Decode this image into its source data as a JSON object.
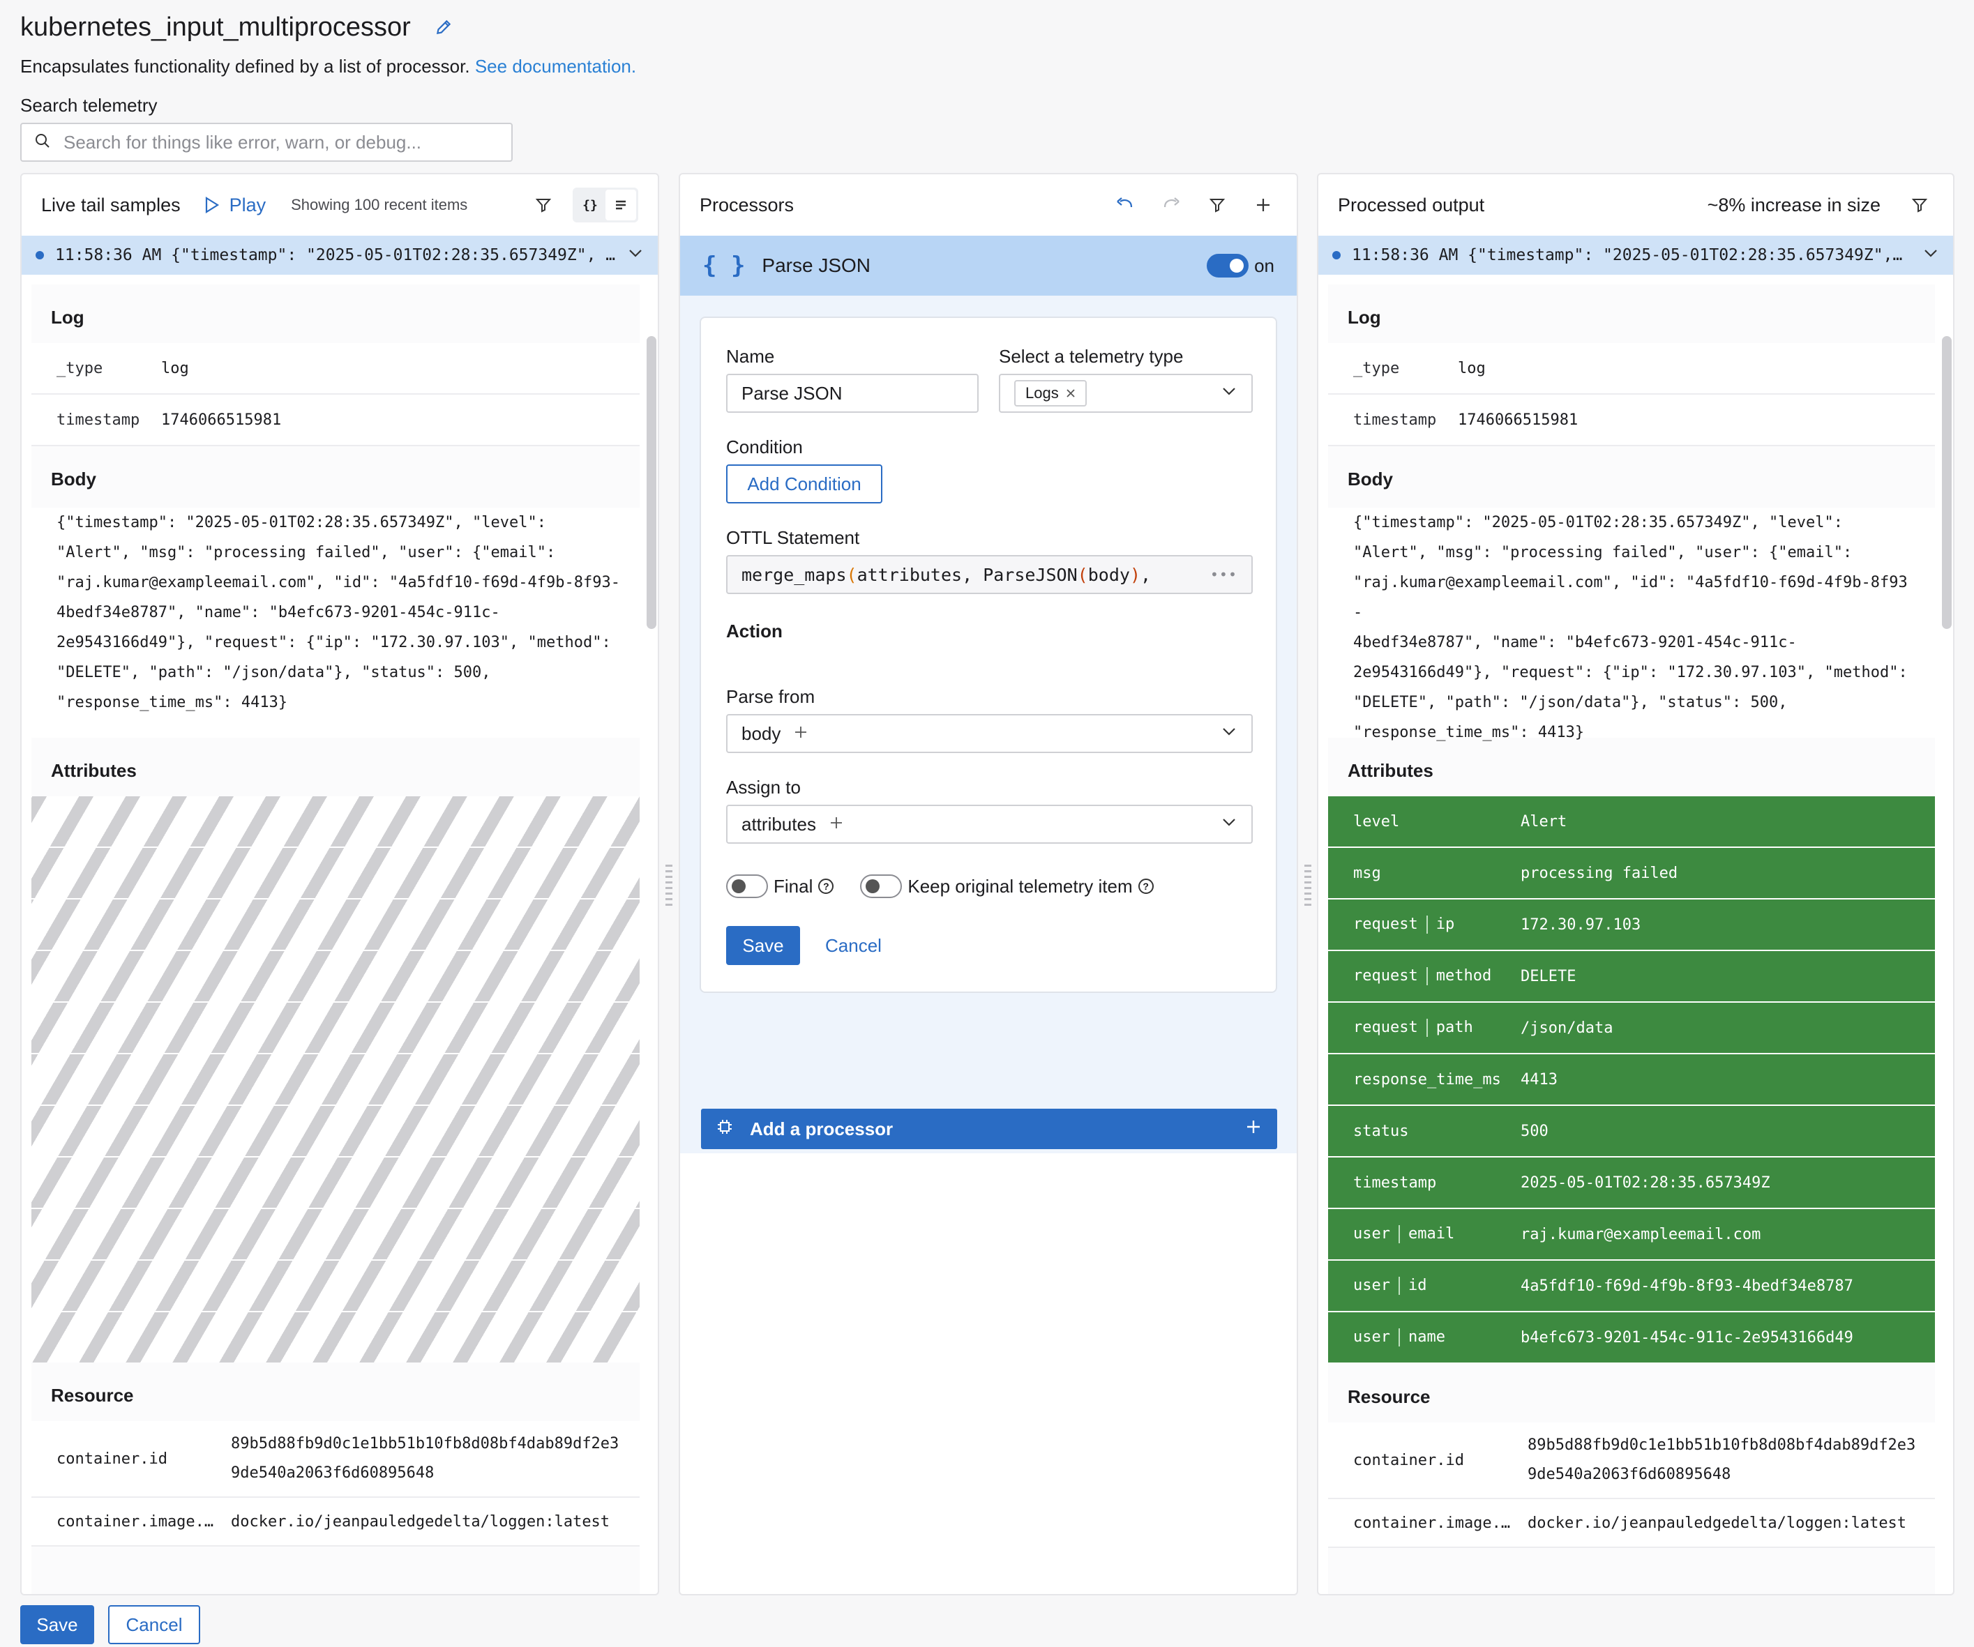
{
  "header": {
    "title": "kubernetes_input_multiprocessor",
    "description": "Encapsulates functionality defined by a list of processor.",
    "doc_link": "See documentation.",
    "search_label": "Search telemetry",
    "search_placeholder": "Search for things like error, warn, or debug..."
  },
  "left_panel": {
    "title": "Live tail samples",
    "play_label": "Play",
    "showing_text": "Showing 100 recent items",
    "json_icon_label": "{}",
    "sample_line": "11:58:36 AM {\"timestamp\": \"2025-05-01T02:28:35.657349Z\", \"le…"
  },
  "log": {
    "section_title": "Log",
    "rows": [
      {
        "key": "_type",
        "value": "log"
      },
      {
        "key": "timestamp",
        "value": "1746066515981"
      }
    ]
  },
  "body": {
    "section_title": "Body",
    "text": "{\"timestamp\": \"2025-05-01T02:28:35.657349Z\", \"level\":\n\"Alert\", \"msg\": \"processing failed\", \"user\": {\"email\":\n\"raj.kumar@exampleemail.com\", \"id\": \"4a5fdf10-f69d-4f9b-8f93-\n4bedf34e8787\", \"name\": \"b4efc673-9201-454c-911c-\n2e9543166d49\"}, \"request\": {\"ip\": \"172.30.97.103\", \"method\":\n\"DELETE\", \"path\": \"/json/data\"}, \"status\": 500,\n\"response_time_ms\": 4413}"
  },
  "attributes": {
    "section_title": "Attributes",
    "processed_rows": [
      {
        "k1": "level",
        "k2": "",
        "value": "Alert"
      },
      {
        "k1": "msg",
        "k2": "",
        "value": "processing failed"
      },
      {
        "k1": "request",
        "k2": "ip",
        "value": "172.30.97.103"
      },
      {
        "k1": "request",
        "k2": "method",
        "value": "DELETE"
      },
      {
        "k1": "request",
        "k2": "path",
        "value": "/json/data"
      },
      {
        "k1": "response_time_ms",
        "k2": "",
        "value": "4413"
      },
      {
        "k1": "status",
        "k2": "",
        "value": "500"
      },
      {
        "k1": "timestamp",
        "k2": "",
        "value": "2025-05-01T02:28:35.657349Z"
      },
      {
        "k1": "user",
        "k2": "email",
        "value": "raj.kumar@exampleemail.com"
      },
      {
        "k1": "user",
        "k2": "id",
        "value": "4a5fdf10-f69d-4f9b-8f93-4bedf34e8787"
      },
      {
        "k1": "user",
        "k2": "name",
        "value": "b4efc673-9201-454c-911c-2e9543166d49"
      }
    ]
  },
  "resource": {
    "section_title": "Resource",
    "rows": [
      {
        "key": "container.id",
        "value": "89b5d88fb9d0c1e1bb51b10fb8d08bf4dab89df2e3\n9de540a2063f6d60895648"
      },
      {
        "key": "container.image.…",
        "value": "docker.io/jeanpauledgedelta/loggen:latest"
      }
    ]
  },
  "processors": {
    "title": "Processors",
    "processor_name": "Parse JSON",
    "toggle_label": "on",
    "name_label": "Name",
    "name_value": "Parse JSON",
    "telemetry_label": "Select a telemetry type",
    "telemetry_chip": "Logs",
    "condition_label": "Condition",
    "add_condition": "Add Condition",
    "ottl_label": "OTTL Statement",
    "ottl_fn": "merge_maps",
    "ottl_arg1": "attributes, ",
    "ottl_fn2": "ParseJSON",
    "ottl_arg2": "body",
    "ottl_tail": ",",
    "action_label": "Action",
    "parse_from_label": "Parse from",
    "parse_from_value": "body",
    "assign_to_label": "Assign to",
    "assign_to_value": "attributes",
    "final_label": "Final",
    "keep_label": "Keep original telemetry item",
    "save": "Save",
    "cancel": "Cancel",
    "add_processor": "Add a processor"
  },
  "right_panel": {
    "title": "Processed output",
    "size_note": "~8% increase in size",
    "sample_line": "11:58:36 AM {\"timestamp\": \"2025-05-01T02:28:35.657349Z\", \"le…"
  },
  "footer": {
    "save": "Save",
    "cancel": "Cancel"
  },
  "colors": {
    "accent": "#2a6cc4",
    "link": "#2a80d4",
    "processed_green": "#3d8a40",
    "selected_sample": "#cfe2f7"
  }
}
